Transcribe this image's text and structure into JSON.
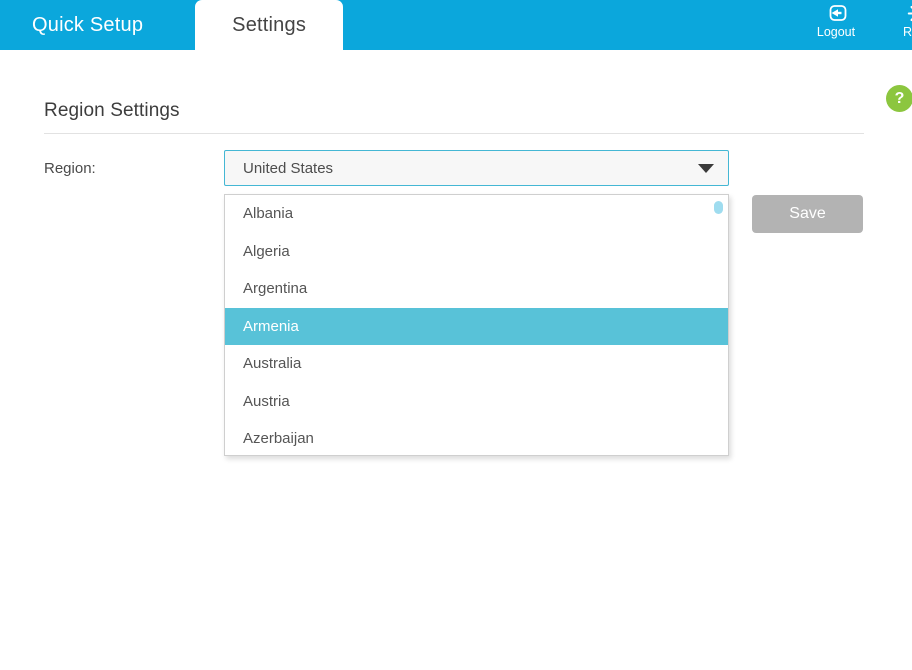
{
  "header": {
    "tabs": [
      {
        "label": "Quick Setup",
        "active": false
      },
      {
        "label": "Settings",
        "active": true
      }
    ],
    "actions": [
      {
        "name": "logout",
        "label": "Logout",
        "icon": "logout-icon"
      },
      {
        "name": "reboot",
        "label": "Rebo",
        "icon": "reboot-icon"
      }
    ],
    "brand_color": "#0ba7dc"
  },
  "help": {
    "symbol": "?",
    "color": "#8cc63f"
  },
  "main": {
    "page_title": "Region Settings",
    "region_field": {
      "label": "Region:",
      "selected_value": "United States",
      "caret_icon": "chevron-down-icon",
      "border_color": "#44b7d4"
    },
    "dropdown": {
      "highlight_color": "#58c2d8",
      "highlighted_option": "Armenia",
      "options": [
        "Albania",
        "Algeria",
        "Argentina",
        "Armenia",
        "Australia",
        "Austria",
        "Azerbaijan"
      ]
    },
    "save_button": {
      "label": "Save",
      "color": "#b3b3b3",
      "enabled": false
    }
  }
}
